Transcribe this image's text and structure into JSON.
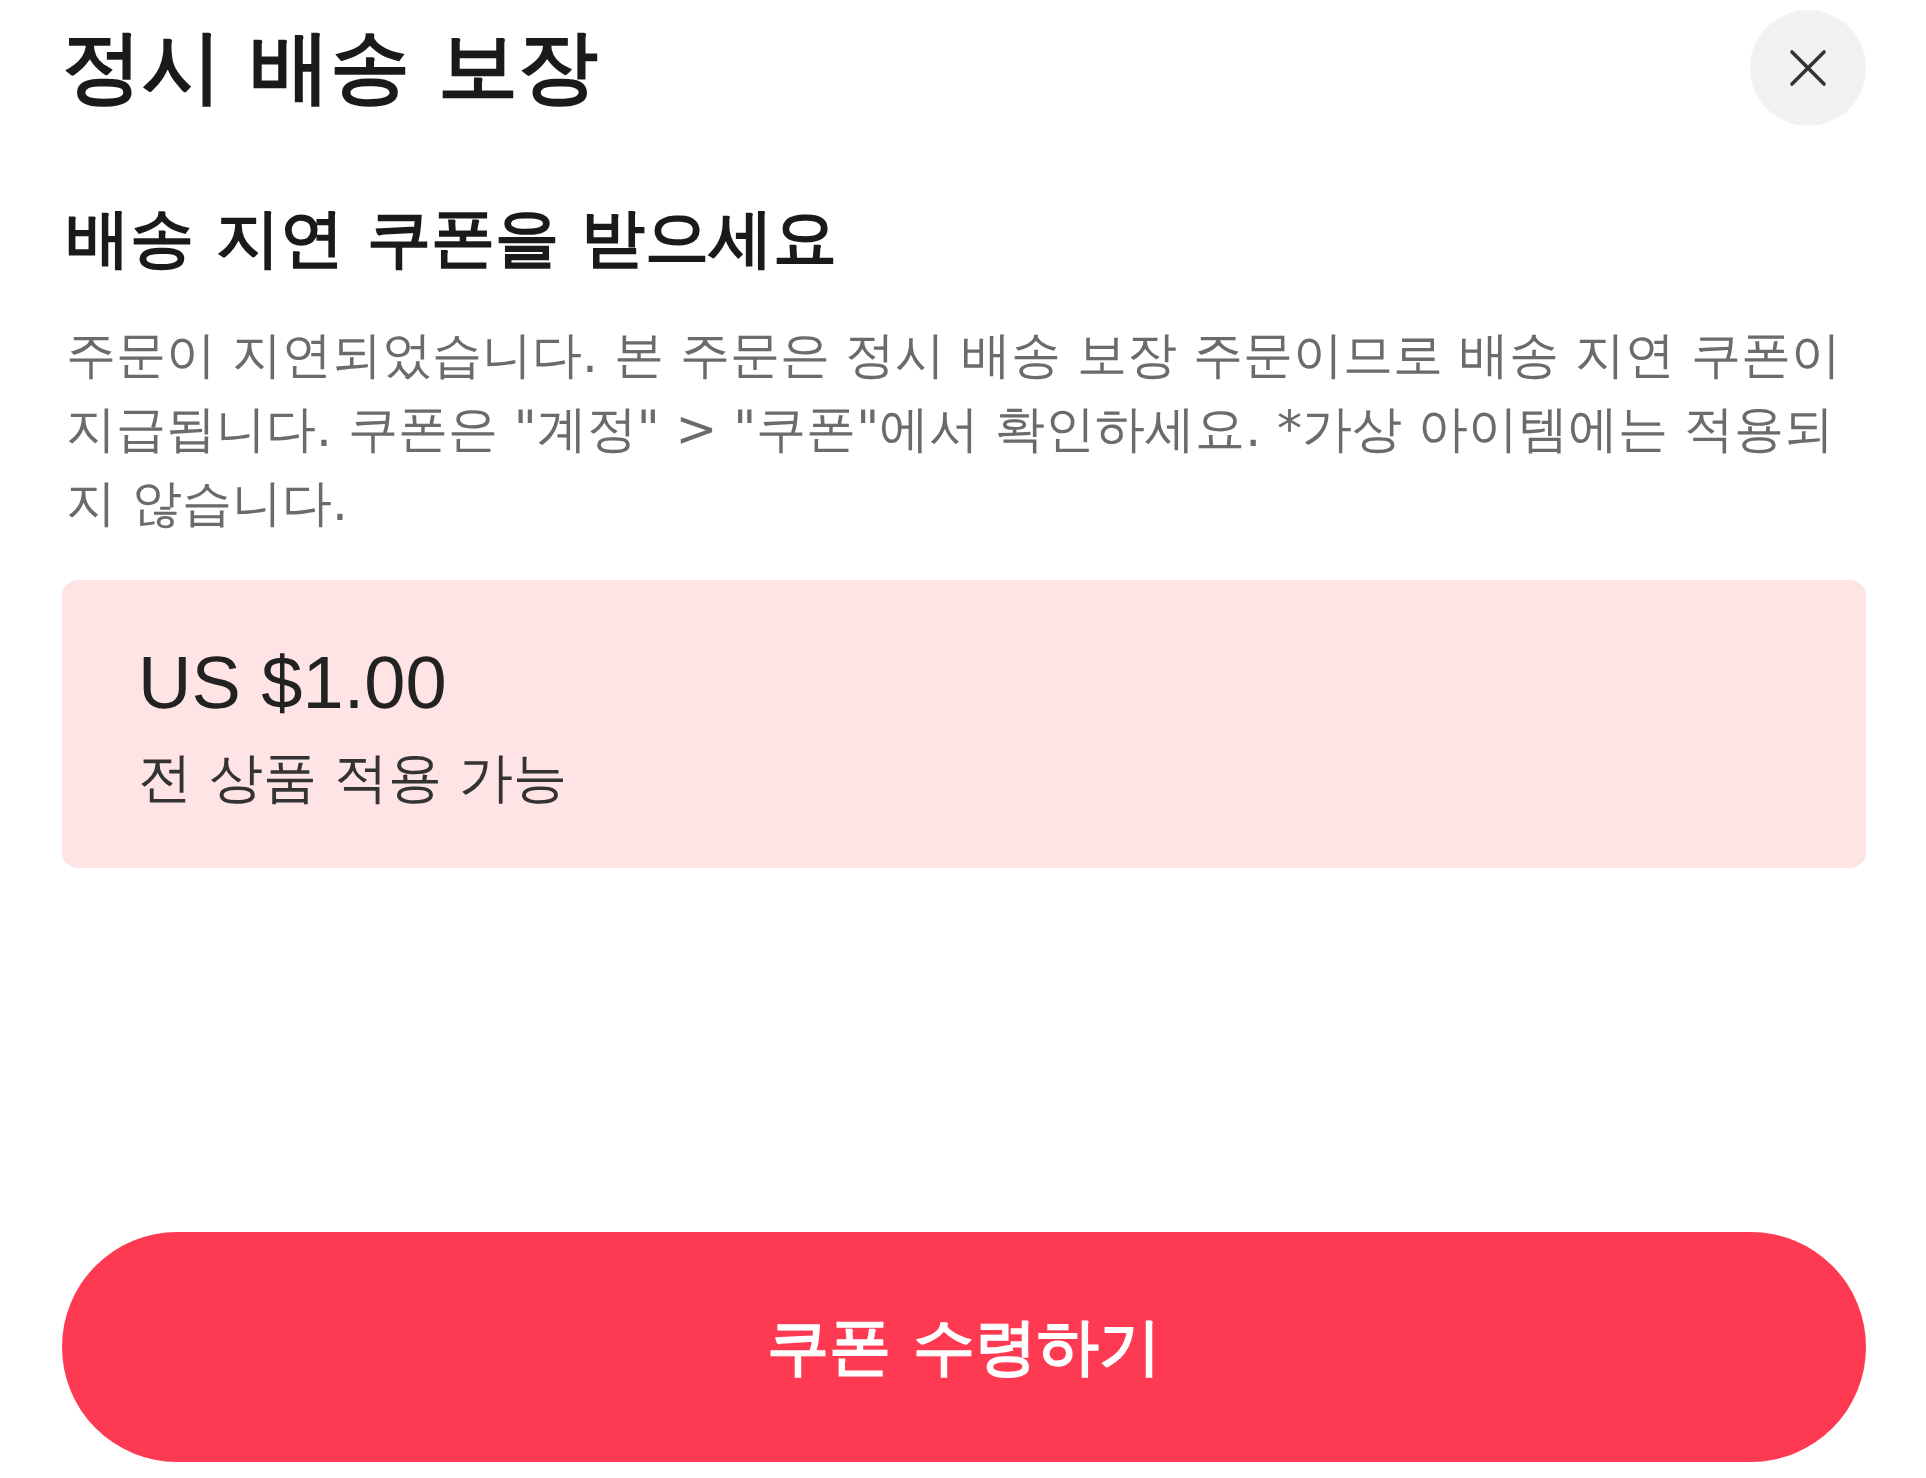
{
  "sheet": {
    "title": "정시 배송 보장"
  },
  "content": {
    "heading": "배송 지연 쿠폰을 받으세요",
    "description": "주문이 지연되었습니다. 본 주문은 정시 배송 보장 주문이므로 배송 지연 쿠폰이 지급됩니다. 쿠폰은 \"계정\" > \"쿠폰\"에서 확인하세요. *가상 아이템에는 적용되지 않습니다."
  },
  "coupon": {
    "amount": "US $1.00",
    "condition": "전 상품 적용 가능"
  },
  "action_button": {
    "label": "쿠폰 수령하기"
  }
}
